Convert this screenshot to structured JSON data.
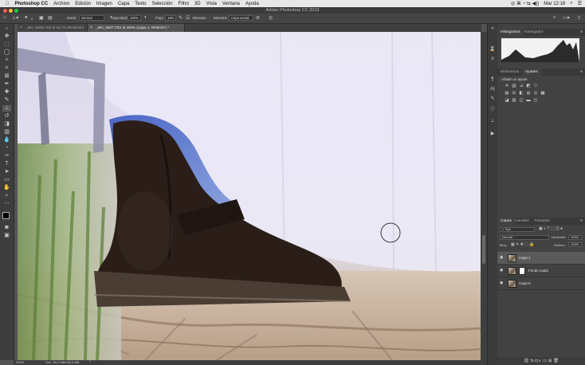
{
  "menubar": {
    "app": "Photoshop CC",
    "items": [
      "Archivo",
      "Edición",
      "Imagen",
      "Capa",
      "Texto",
      "Selección",
      "Filtro",
      "3D",
      "Vista",
      "Ventana",
      "Ayuda"
    ],
    "clock": "Mar 12:18"
  },
  "window": {
    "title": "Adobe Photoshop CC 2019"
  },
  "options": {
    "brush_size": "9",
    "mode_label": "Modo:",
    "mode_value": "Normal",
    "opacity_label": "Opacidad:",
    "opacity_value": "100%",
    "flow_label": "Flujo:",
    "flow_value": "19%",
    "aligned_label": "Alineado",
    "sample_label": "Muestra:",
    "sample_value": "Capa actual"
  },
  "tabs": [
    {
      "label": "_MG_6498.CR2 al 16,7% (RGB/16*)"
    },
    {
      "label": "_MG_6507.CR2 al 200% (Capa 1, RGB/16*) *"
    }
  ],
  "status": {
    "zoom": "200%",
    "doc": "Doc: 95,2 MB/344,0 MB"
  },
  "panels": {
    "top_tabs": [
      "Histograma",
      "Navegador"
    ],
    "mid_tabs": [
      "Bibliotecas",
      "Ajustes"
    ],
    "adjust_title": "Añadir un ajuste",
    "layer_tabs": [
      "Capas",
      "Canales",
      "Trazados"
    ],
    "filter_value": "Tipo",
    "blend_value": "Normal",
    "opacity_label": "Opacidad:",
    "opacity_value": "100%",
    "lock_label": "Bloq.:",
    "fill_label": "Relleno:",
    "fill_value": "100%",
    "layers": [
      {
        "name": "Capa 1",
        "selected": true,
        "mask": false
      },
      {
        "name": "Fondo copia",
        "selected": false,
        "mask": true
      },
      {
        "name": "Capa 0",
        "selected": false,
        "mask": false
      }
    ]
  },
  "icons": {
    "apple": "apple-icon",
    "brush_cursor": "clone-stamp-cursor"
  },
  "colors": {
    "ui_dark": "#3d3d3d",
    "ui_mid": "#535353",
    "panel": "#424242"
  }
}
